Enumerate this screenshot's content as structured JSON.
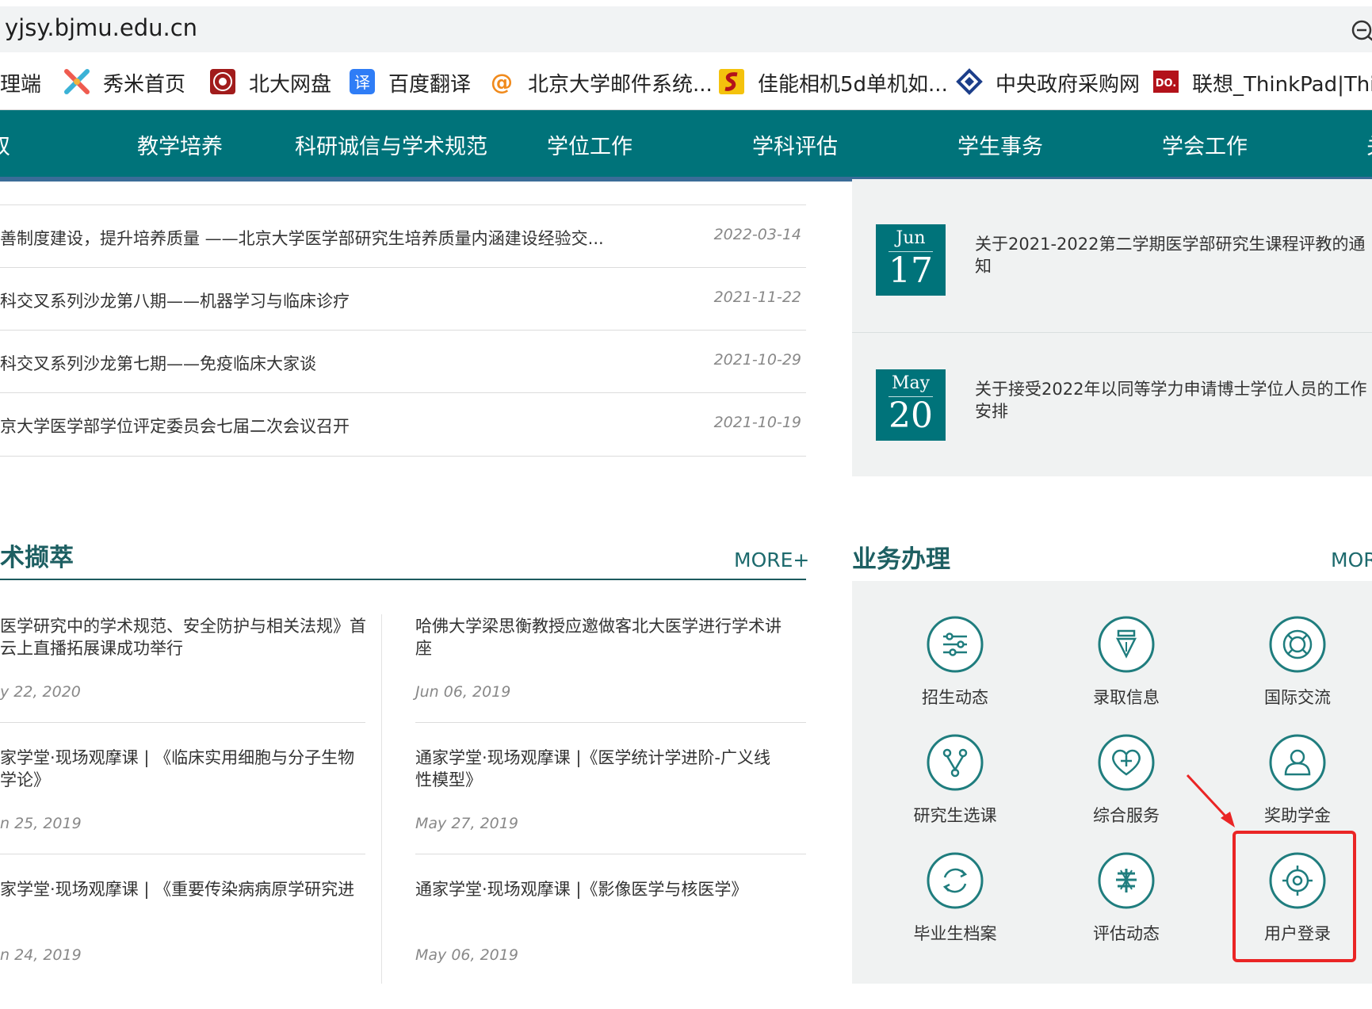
{
  "browser": {
    "url": "yjsy.bjmu.edu.cn",
    "bookmarks": [
      {
        "label": "理端",
        "icon": "none"
      },
      {
        "label": "秀米首页",
        "icon": "xiumi-icon"
      },
      {
        "label": "北大网盘",
        "icon": "pku-seal-icon"
      },
      {
        "label": "百度翻译",
        "icon": "translate-icon"
      },
      {
        "label": "北京大学邮件系统...",
        "icon": "mail-at-icon"
      },
      {
        "label": "佳能相机5d单机如...",
        "icon": "sogou-icon"
      },
      {
        "label": "中央政府采购网",
        "icon": "diamond-icon"
      },
      {
        "label": "联想_ThinkPad|Thi...",
        "icon": "lenovo-icon"
      }
    ]
  },
  "nav": {
    "items": [
      "双",
      "教学培养",
      "科研诚信与学术规范",
      "学位工作",
      "学科评估",
      "学生事务",
      "学会工作",
      "关"
    ]
  },
  "news": [
    {
      "title": "善制度建设，提升培养质量 ——北京大学医学部研究生培养质量内涵建设经验交...",
      "date": "2022-03-14"
    },
    {
      "title": "科交叉系列沙龙第八期——机器学习与临床诊疗",
      "date": "2021-11-22"
    },
    {
      "title": "科交叉系列沙龙第七期——免疫临床大家谈",
      "date": "2021-10-29"
    },
    {
      "title": "京大学医学部学位评定委员会七届二次会议召开",
      "date": "2021-10-19"
    }
  ],
  "notices": [
    {
      "month": "Jun",
      "day": "17",
      "title": "关于2021-2022第二学期医学部研究生课程评教的通知"
    },
    {
      "month": "May",
      "day": "20",
      "title": "关于接受2022年以同等学力申请博士学位人员的工作安排"
    }
  ],
  "academic": {
    "title": "术撷萃",
    "more": "MORE+",
    "cards": [
      {
        "title": "医学研究中的学术规范、安全防护与相关法规》首云上直播拓展课成功举行",
        "date": "y 22, 2020"
      },
      {
        "title": "哈佛大学梁思衡教授应邀做客北大医学进行学术讲座",
        "date": "Jun 06, 2019"
      },
      {
        "title": "家学堂·现场观摩课 | 《临床实用细胞与分子生物学论》",
        "date": "n 25, 2019"
      },
      {
        "title": "通家学堂·现场观摩课 |《医学统计学进阶-广义线性模型》",
        "date": "May 27, 2019"
      },
      {
        "title": "家学堂·现场观摩课 | 《重要传染病病原学研究进",
        "date": "n 24, 2019"
      },
      {
        "title": "通家学堂·现场观摩课 |《影像医学与核医学》",
        "date": "May 06, 2019"
      }
    ]
  },
  "services": {
    "title": "业务办理",
    "more": "MOR",
    "items": [
      {
        "label": "招生动态",
        "icon": "sliders-icon"
      },
      {
        "label": "录取信息",
        "icon": "pen-nib-icon"
      },
      {
        "label": "国际交流",
        "icon": "lifebuoy-icon"
      },
      {
        "label": "研究生选课",
        "icon": "branch-icon"
      },
      {
        "label": "综合服务",
        "icon": "heart-plus-icon"
      },
      {
        "label": "奖助学金",
        "icon": "user-icon"
      },
      {
        "label": "毕业生档案",
        "icon": "refresh-icon"
      },
      {
        "label": "评估动态",
        "icon": "pku-logo-icon"
      },
      {
        "label": "用户登录",
        "icon": "target-icon"
      }
    ]
  },
  "colors": {
    "primary": "#00737a",
    "nav_border": "#3a6c98",
    "highlight": "#ea2525"
  }
}
